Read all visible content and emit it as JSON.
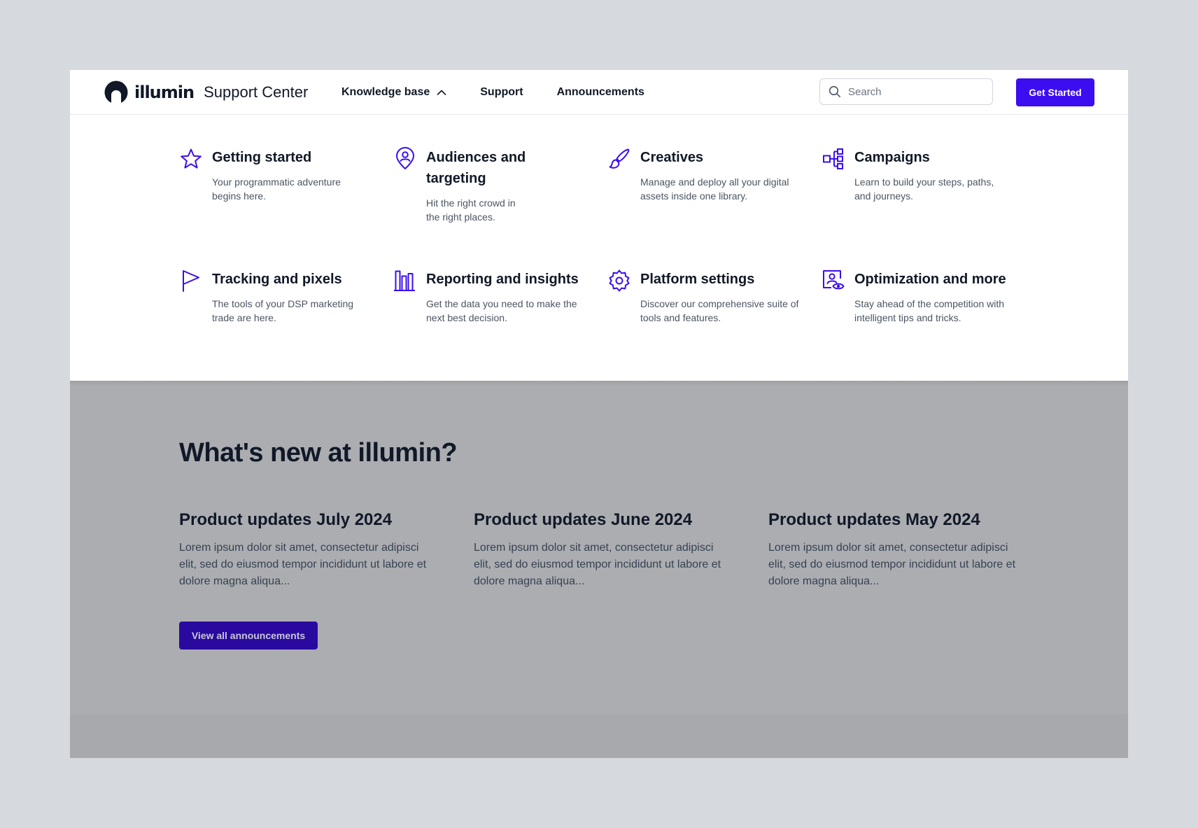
{
  "header": {
    "logo_word": "illumin",
    "logo_subtitle": "Support Center",
    "nav": [
      {
        "label": "Knowledge base",
        "expanded": true
      },
      {
        "label": "Support"
      },
      {
        "label": "Announcements"
      }
    ],
    "search_placeholder": "Search",
    "cta_label": "Get Started"
  },
  "menu": {
    "items": [
      {
        "title": "Getting started",
        "desc": "Your programmatic adventure begins here.",
        "icon": "star-icon"
      },
      {
        "title": "Audiences and targeting",
        "desc": "Hit the right crowd in the right places.",
        "icon": "location-user-icon"
      },
      {
        "title": "Creatives",
        "desc": "Manage and deploy all your digital assets inside one library.",
        "icon": "brush-icon"
      },
      {
        "title": "Campaigns",
        "desc": "Learn to build your steps, paths, and journeys.",
        "icon": "flow-icon"
      },
      {
        "title": "Tracking and pixels",
        "desc": "The tools of your DSP marketing trade are here.",
        "icon": "flag-icon"
      },
      {
        "title": "Reporting and insights",
        "desc": "Get the data you need to make the next best decision.",
        "icon": "bar-chart-icon"
      },
      {
        "title": "Platform settings",
        "desc": "Discover our comprehensive suite of tools and features.",
        "icon": "gear-icon"
      },
      {
        "title": "Optimization and more",
        "desc": "Stay ahead of the competition with intelligent tips and tricks.",
        "icon": "profile-view-icon"
      }
    ]
  },
  "news": {
    "heading": "What's new at illumin?",
    "items": [
      {
        "title": "Product updates July 2024",
        "body": "Lorem ipsum dolor sit amet, consectetur adipisci elit, sed do eiusmod tempor incididunt ut labore et dolore magna aliqua..."
      },
      {
        "title": "Product updates June 2024",
        "body": "Lorem ipsum dolor sit amet, consectetur adipisci elit, sed do eiusmod tempor incididunt ut labore et dolore magna aliqua..."
      },
      {
        "title": "Product updates May 2024",
        "body": "Lorem ipsum dolor sit amet, consectetur adipisci elit, sed do eiusmod tempor incididunt ut labore et dolore magna aliqua..."
      }
    ],
    "view_all_label": "View all announcements"
  },
  "colors": {
    "accent": "#3b0df0",
    "icon": "#3b0df0",
    "overlay": "#abadb1",
    "backdrop": "#d6d9de"
  }
}
